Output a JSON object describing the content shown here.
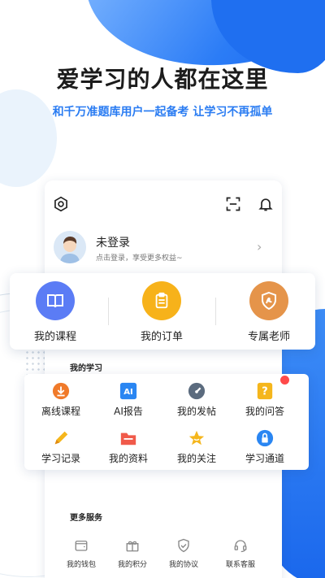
{
  "hero": {
    "headline": "爱学习的人都在这里",
    "subline": "和千万准题库用户一起备考 让学习不再孤单"
  },
  "profile": {
    "title": "未登录",
    "subtitle": "点击登录，享受更多权益~"
  },
  "quick_actions": [
    {
      "label": "我的课程",
      "icon": "book-icon",
      "color": "#5b7cf5"
    },
    {
      "label": "我的订单",
      "icon": "clipboard-icon",
      "color": "#f7b21a"
    },
    {
      "label": "专属老师",
      "icon": "teacher-badge-icon",
      "color": "#e5944a"
    }
  ],
  "my_study": {
    "title": "我的学习",
    "items": [
      {
        "label": "离线课程",
        "icon": "download-icon",
        "color": "#f07a2a"
      },
      {
        "label": "AI报告",
        "icon": "ai-icon",
        "color": "#2a86f2"
      },
      {
        "label": "我的发帖",
        "icon": "gauge-icon",
        "color": "#5b6b7e"
      },
      {
        "label": "我的问答",
        "icon": "question-icon",
        "color": "#f5b61c"
      },
      {
        "label": "学习记录",
        "icon": "pencil-icon",
        "color": "#f5b61c"
      },
      {
        "label": "我的资料",
        "icon": "folder-icon",
        "color": "#f05a4a"
      },
      {
        "label": "我的关注",
        "icon": "star-icon",
        "color": "#f5b61c"
      },
      {
        "label": "学习通道",
        "icon": "lock-icon",
        "color": "#2a86f2"
      }
    ]
  },
  "more_services": {
    "title": "更多服务",
    "items": [
      {
        "label": "我的钱包",
        "icon": "wallet-icon"
      },
      {
        "label": "我的积分",
        "icon": "gift-icon"
      },
      {
        "label": "我的协议",
        "icon": "shield-check-icon"
      },
      {
        "label": "联系客服",
        "icon": "headset-icon"
      }
    ]
  },
  "colors": {
    "accent": "#2a7cf2",
    "badge": "#ff4a4a"
  }
}
